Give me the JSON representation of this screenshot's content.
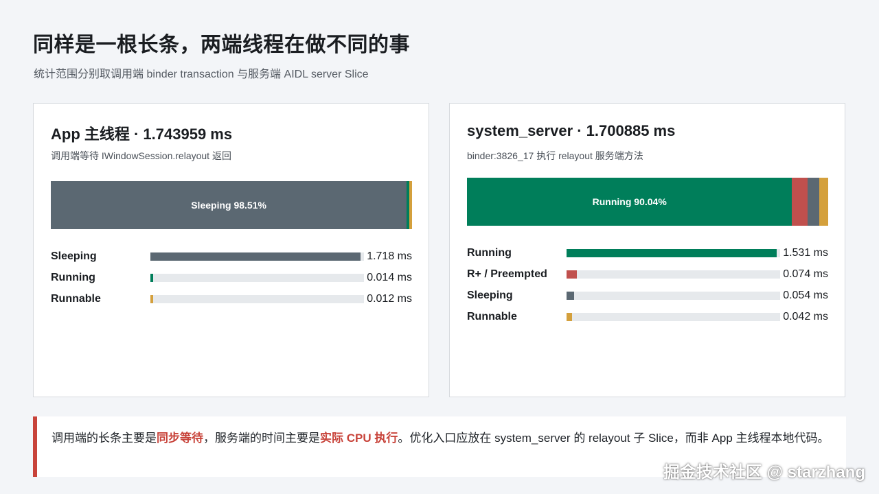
{
  "title": "同样是一根长条，两端线程在做不同的事",
  "subtitle": "统计范围分别取调用端 binder transaction 与服务端 AIDL server Slice",
  "colors": {
    "Sleeping": "#5b6872",
    "Running": "#007e5a",
    "Runnable": "#d4a03c",
    "R+ / Preempted": "#c0504d",
    "accent": "#c8433a"
  },
  "chart_data": [
    {
      "type": "bar",
      "title": "App 主线程 · 1.743959 ms",
      "subtitle": "调用端等待 IWindowSession.relayout 返回",
      "unit": "ms",
      "stacked_label": "Sleeping 98.51%",
      "categories": [
        "Sleeping",
        "Running",
        "Runnable"
      ],
      "values": [
        1.718,
        0.014,
        0.012
      ],
      "value_labels": [
        "1.718 ms",
        "0.014 ms",
        "0.012 ms"
      ]
    },
    {
      "type": "bar",
      "title": "system_server · 1.700885 ms",
      "subtitle": "binder:3826_17 执行 relayout 服务端方法",
      "unit": "ms",
      "stacked_label": "Running 90.04%",
      "categories": [
        "Running",
        "R+ / Preempted",
        "Sleeping",
        "Runnable"
      ],
      "values": [
        1.531,
        0.074,
        0.054,
        0.042
      ],
      "value_labels": [
        "1.531 ms",
        "0.074 ms",
        "0.054 ms",
        "0.042 ms"
      ]
    }
  ],
  "note": {
    "t1": "调用端的长条主要是",
    "h1": "同步等待",
    "t2": "，服务端的时间主要是",
    "h2": "实际 CPU 执行",
    "t3": "。优化入口应放在 system_server 的 relayout 子 Slice，而非 App 主线程本地代码。"
  },
  "watermark": "掘金技术社区 @ starzhang"
}
